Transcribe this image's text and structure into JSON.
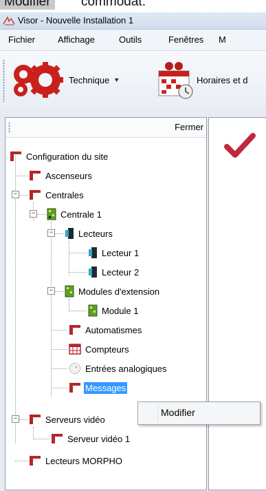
{
  "caption": {
    "highlighted": "Modifier",
    "rest": "commodat."
  },
  "window": {
    "title": "Visor - Nouvelle Installation 1"
  },
  "menu": [
    "Fichier",
    "Affichage",
    "Outils",
    "Fenêtres",
    "M"
  ],
  "toolbar": {
    "technique_label": "Technique",
    "horaires_label": "Horaires et d"
  },
  "panel": {
    "close_label": "Fermer"
  },
  "tree": [
    {
      "label": "Configuration du site"
    },
    {
      "label": "Ascenseurs"
    },
    {
      "label": "Centrales"
    },
    {
      "label": "Centrale 1"
    },
    {
      "label": "Lecteurs"
    },
    {
      "label": "Lecteur 1"
    },
    {
      "label": "Lecteur 2"
    },
    {
      "label": "Modules d'extension"
    },
    {
      "label": "Module 1"
    },
    {
      "label": "Automatismes"
    },
    {
      "label": "Compteurs"
    },
    {
      "label": "Entrées analogiques"
    },
    {
      "label": "Messages"
    },
    {
      "label": "Serveurs vidéo"
    },
    {
      "label": "Serveur vidéo 1"
    },
    {
      "label": "Lecteurs MORPHO"
    }
  ],
  "context_menu": {
    "items": [
      "Modifier"
    ]
  },
  "colors": {
    "folder_red": "#b3262b",
    "selection": "#3399ff",
    "check_red": "#c0283c"
  }
}
